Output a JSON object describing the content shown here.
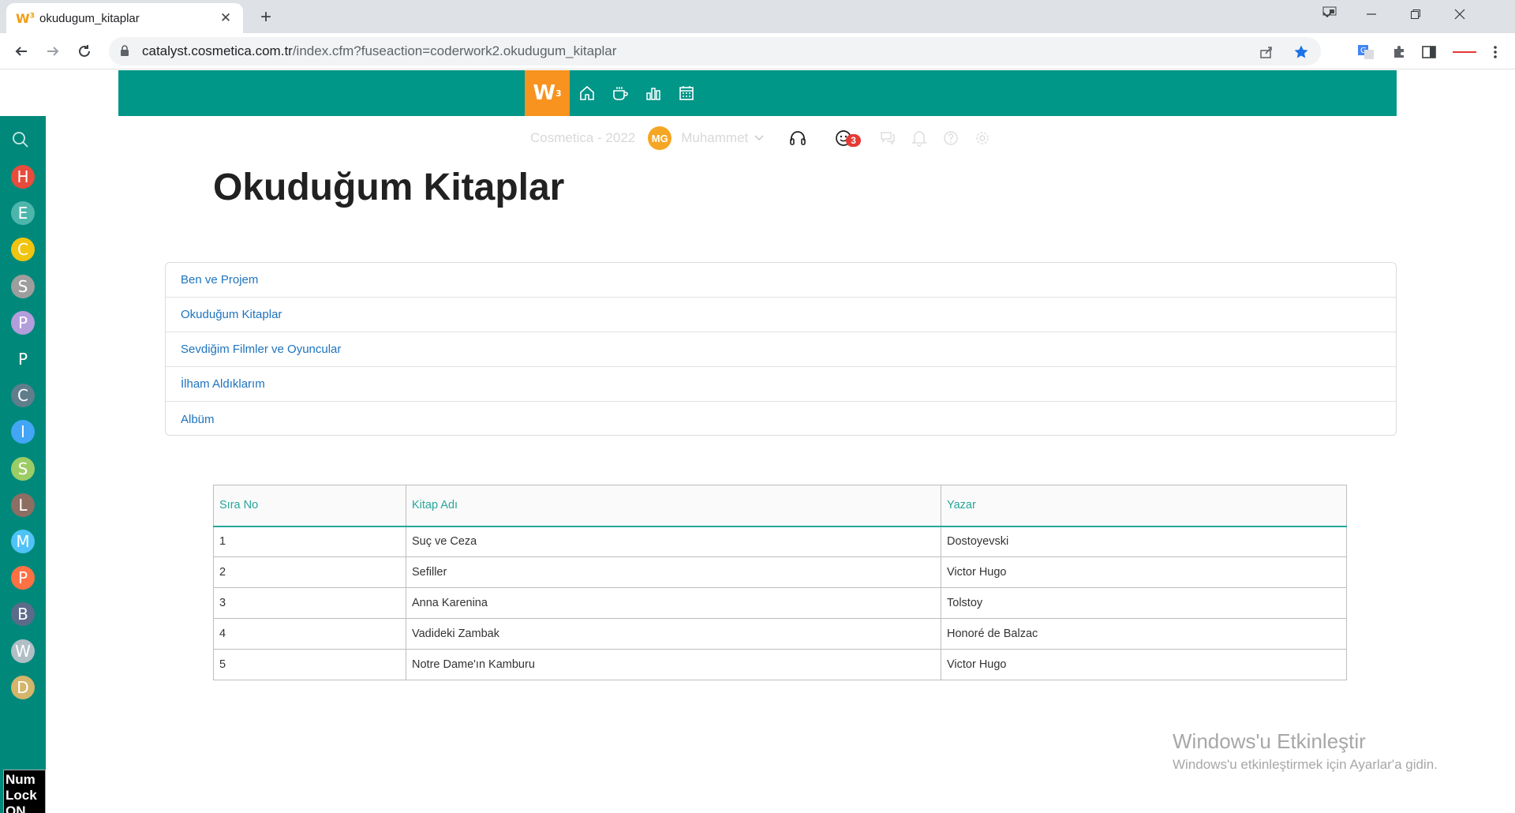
{
  "browser": {
    "tab_title": "okudugum_kitaplar",
    "favicon_text": "W",
    "favicon_sup": "3",
    "url_host": "catalyst.cosmetica.com.tr",
    "url_path": "/index.cfm?fuseaction=coderwork2.okudugum_kitaplar"
  },
  "app": {
    "logo_text": "W",
    "logo_sup": "3"
  },
  "userbar": {
    "period": "Cosmetica - 2022",
    "avatar_initials": "MG",
    "username": "Muhammet",
    "notification_count": "3"
  },
  "sidebar": {
    "items": [
      {
        "letter": "H",
        "color": "#e74c3c"
      },
      {
        "letter": "E",
        "color": "#4db6ac"
      },
      {
        "letter": "C",
        "color": "#f1c40f"
      },
      {
        "letter": "S",
        "color": "#9e9e9e"
      },
      {
        "letter": "P",
        "color": "#b39ddb"
      },
      {
        "letter": "P",
        "color": "#00897b"
      },
      {
        "letter": "C",
        "color": "#607d8b"
      },
      {
        "letter": "I",
        "color": "#42a5f5"
      },
      {
        "letter": "S",
        "color": "#9ccc65"
      },
      {
        "letter": "L",
        "color": "#8d6e63"
      },
      {
        "letter": "M",
        "color": "#4fc3f7"
      },
      {
        "letter": "P",
        "color": "#ff7043"
      },
      {
        "letter": "B",
        "color": "#5c6b8a"
      },
      {
        "letter": "W",
        "color": "#b0bec5"
      },
      {
        "letter": "D",
        "color": "#d4b56a"
      }
    ],
    "numlock": "Num Lock ON"
  },
  "page": {
    "title": "Okuduğum Kitaplar",
    "menu": [
      "Ben ve Projem",
      "Okuduğum Kitaplar",
      "Sevdiğim Filmler ve Oyuncular",
      "İlham Aldıklarım",
      "Albüm"
    ]
  },
  "table": {
    "headers": [
      "Sıra No",
      "Kitap Adı",
      "Yazar"
    ],
    "rows": [
      [
        "1",
        "Suç ve Ceza",
        "Dostoyevski"
      ],
      [
        "2",
        "Sefiller",
        "Victor Hugo"
      ],
      [
        "3",
        "Anna Karenina",
        "Tolstoy"
      ],
      [
        "4",
        "Vadideki Zambak",
        "Honoré de Balzac"
      ],
      [
        "5",
        "Notre Dame'ın Kamburu",
        "Victor Hugo"
      ]
    ]
  },
  "watermark": {
    "title": "Windows'u Etkinleştir",
    "subtitle": "Windows'u etkinleştirmek için Ayarlar'a gidin."
  },
  "colors": {
    "header": "#009688",
    "sidebar": "#00897b",
    "logo": "#f7931e",
    "link": "#1e73be",
    "table_header": "#26a69a"
  }
}
